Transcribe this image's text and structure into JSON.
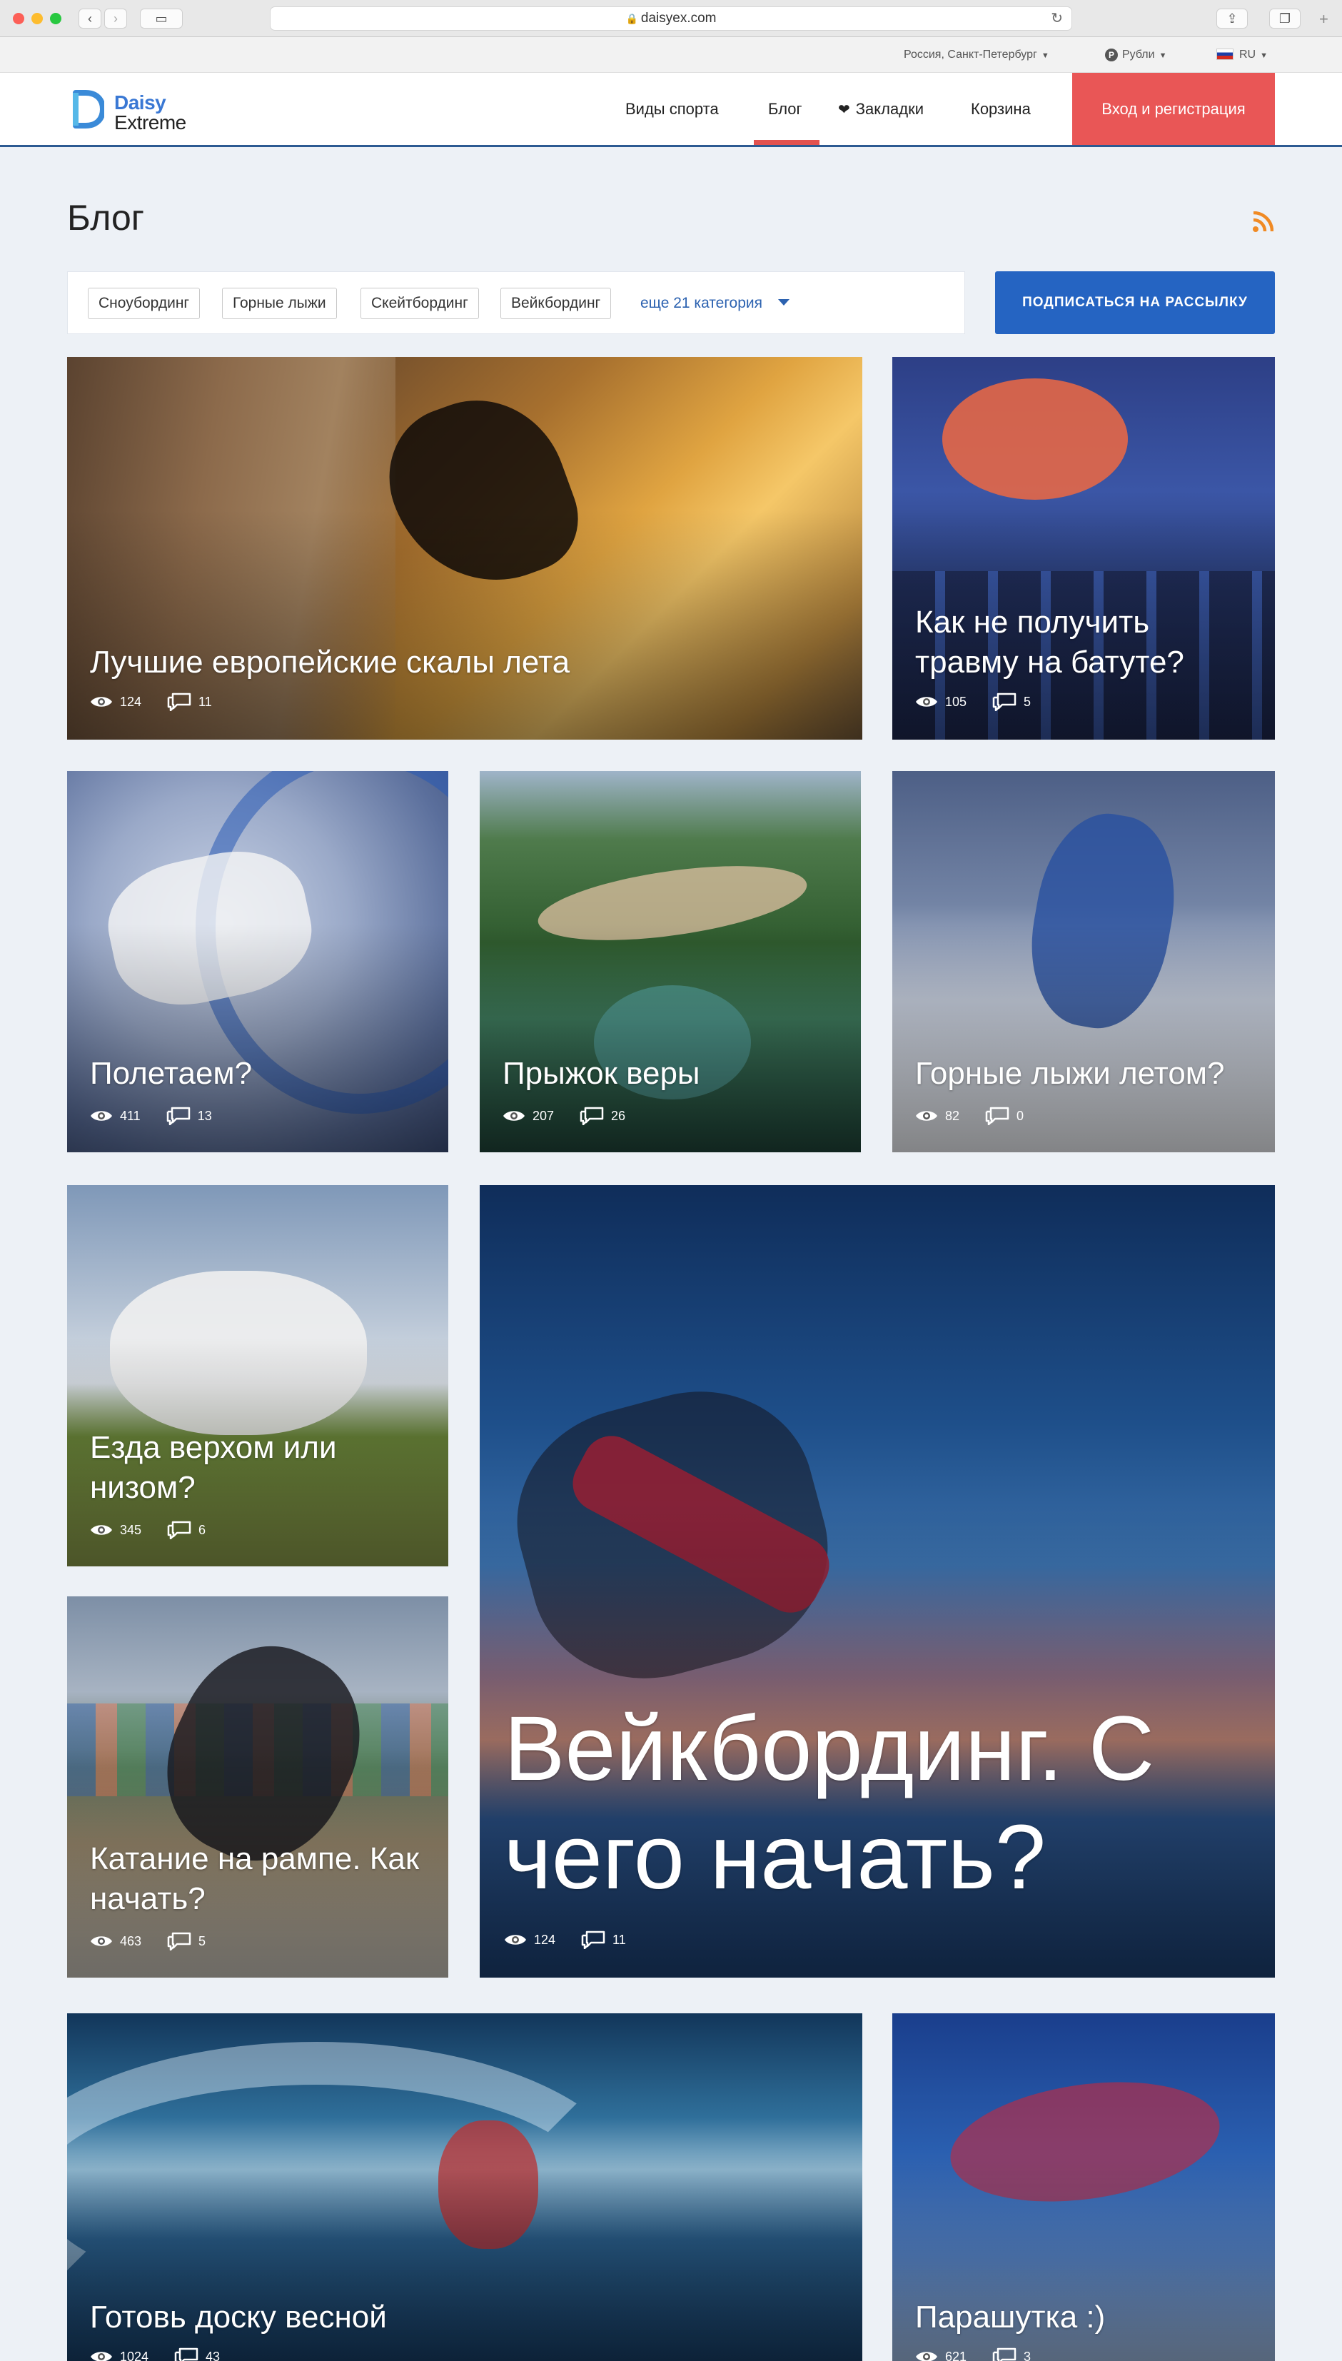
{
  "browser": {
    "url": "daisyex.com"
  },
  "utilbar": {
    "region": "Россия, Санкт-Петербург",
    "currency": "Рубли",
    "currency_symbol": "Р",
    "language": "RU"
  },
  "header": {
    "logo_line1": "Daisy",
    "logo_line2": "Extreme",
    "nav": {
      "sports": "Виды спорта",
      "blog": "Блог",
      "bookmarks": "Закладки",
      "cart": "Корзина"
    },
    "login": "Вход и регистрация"
  },
  "page": {
    "title": "Блог"
  },
  "filters": {
    "tags": [
      "Сноубординг",
      "Горные лыжи",
      "Скейтбординг",
      "Вейкбординг"
    ],
    "more": "еще 21 категория"
  },
  "subscribe": "ПОДПИСАТЬСЯ НА РАССЫЛКУ",
  "posts": [
    {
      "title": "Лучшие европейские скалы лета",
      "views": "124",
      "comments": "11"
    },
    {
      "title": "Как не получить травму на батуте?",
      "views": "105",
      "comments": "5"
    },
    {
      "title": "Полетаем?",
      "views": "411",
      "comments": "13"
    },
    {
      "title": "Прыжок веры",
      "views": "207",
      "comments": "26"
    },
    {
      "title": "Горные лыжи летом?",
      "views": "82",
      "comments": "0"
    },
    {
      "title": "Езда верхом или низом?",
      "views": "345",
      "comments": "6"
    },
    {
      "title": "Катание на рампе. Как начать?",
      "views": "463",
      "comments": "5"
    },
    {
      "title": "Вейкбординг. С чего начать?",
      "views": "124",
      "comments": "11"
    },
    {
      "title": "Готовь доску весной",
      "views": "1024",
      "comments": "43"
    },
    {
      "title": "Парашутка :)",
      "views": "621",
      "comments": "3"
    }
  ],
  "colors": {
    "accent_red": "#e95656",
    "accent_blue": "#2564c2",
    "link_blue": "#2c62b0",
    "header_border": "#2c5a92",
    "rss": "#f08a24",
    "page_bg": "#edf1f6"
  }
}
